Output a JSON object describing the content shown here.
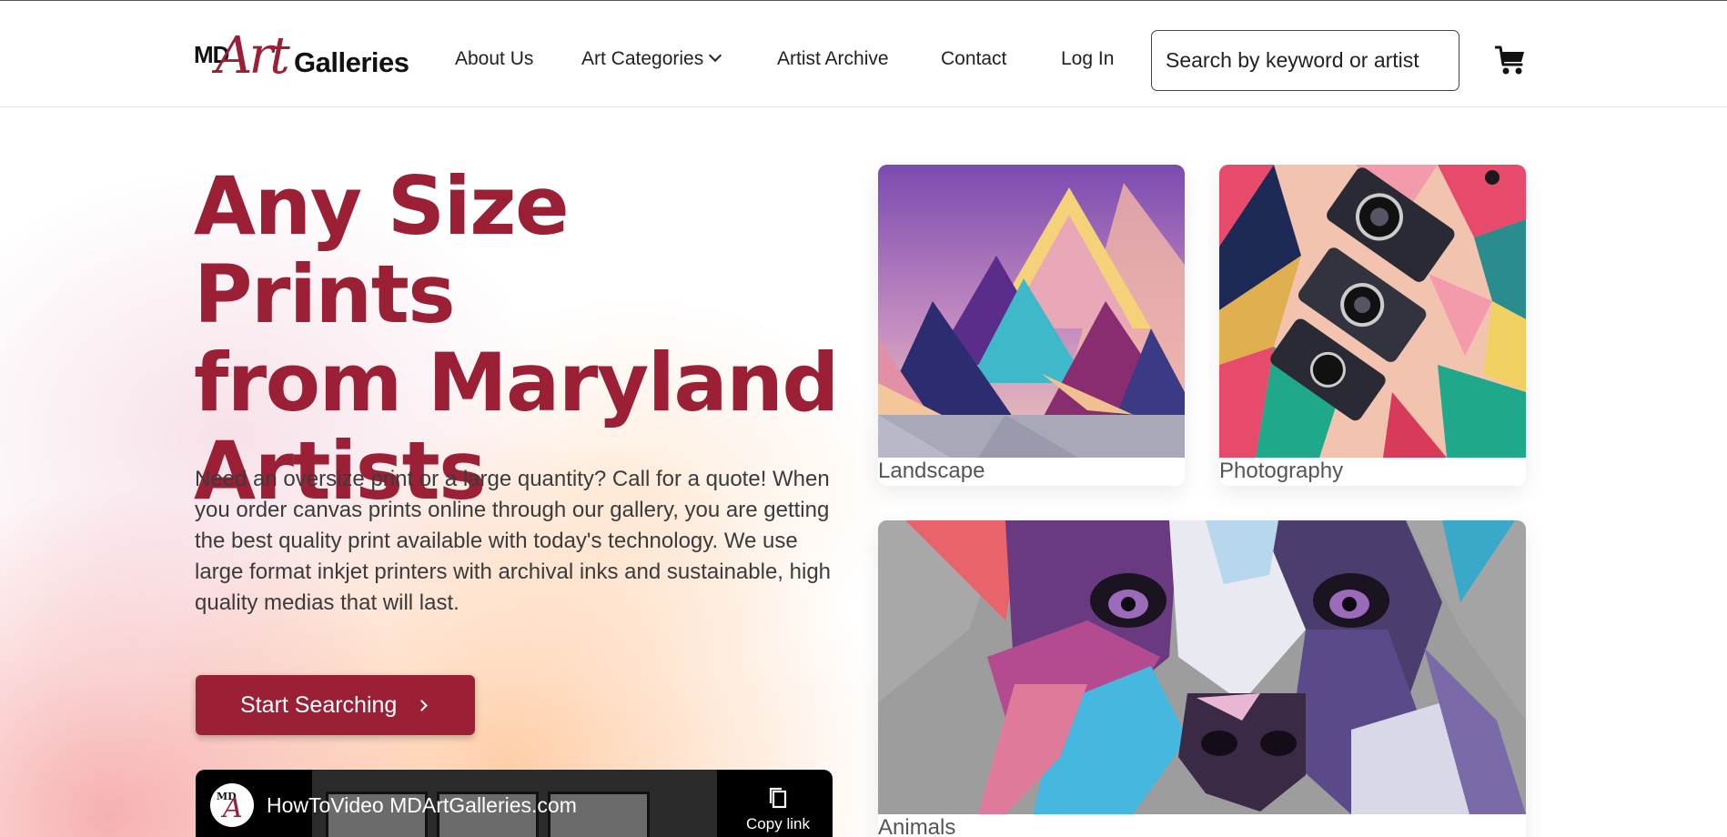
{
  "header": {
    "logo": {
      "md": "MD",
      "art": "Art",
      "galleries": "Galleries"
    },
    "nav": [
      {
        "label": "About Us"
      },
      {
        "label": "Art Categories"
      },
      {
        "label": "Artist Archive"
      },
      {
        "label": "Contact"
      },
      {
        "label": "Log In"
      }
    ],
    "search": {
      "placeholder": "Search by keyword or artist"
    },
    "cart_icon": "cart-icon"
  },
  "hero": {
    "title_lines": [
      "Any Size Prints",
      "from Maryland",
      "Artists"
    ],
    "paragraph": "Need an oversize print or a large quantity? Call for a quote! When you order canvas prints online through our gallery, you are getting the best quality print available with today's technology. We use large format inkjet printers with archival inks and sustainable, high quality medias that will last.",
    "cta_label": "Start Searching"
  },
  "video": {
    "title": "HowToVideo MDArtGalleries.com",
    "copy_label": "Copy link"
  },
  "categories": [
    {
      "label": "Landscape"
    },
    {
      "label": "Photography"
    },
    {
      "label": "Animals"
    }
  ],
  "colors": {
    "brand": "#9b1f35",
    "text": "#3b3b3b"
  }
}
